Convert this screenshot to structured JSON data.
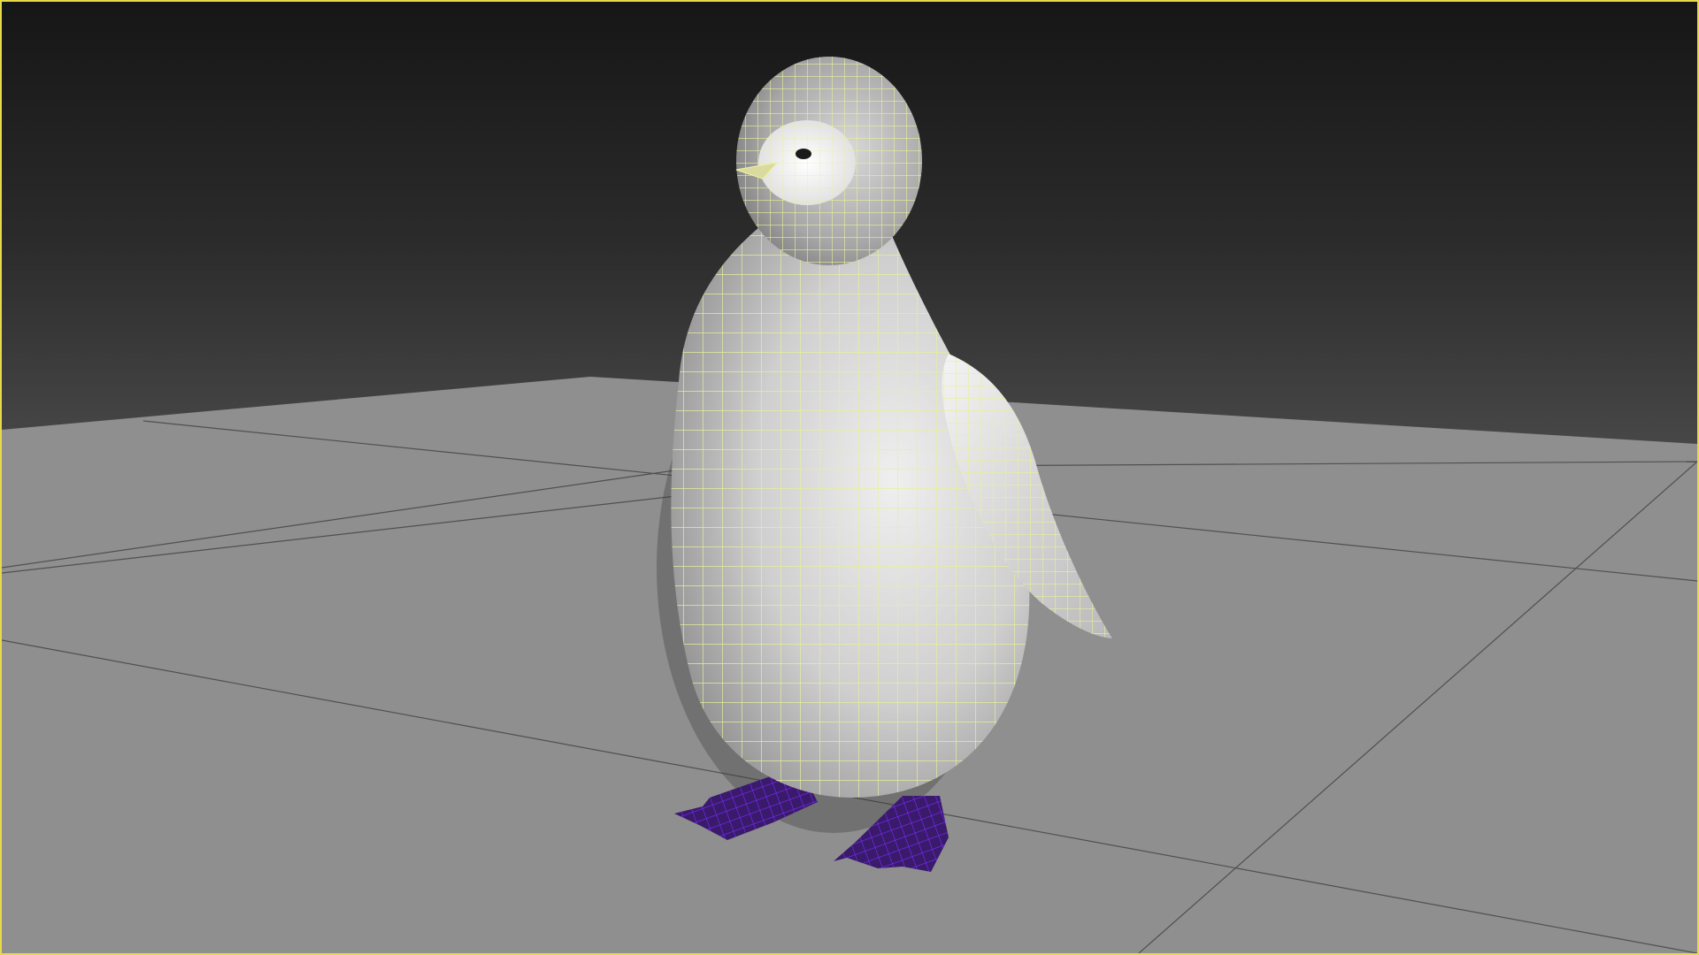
{
  "viewport": {
    "name": "3d-viewport",
    "active_border_color": "#e8d94a",
    "background_top_color": "#161616",
    "background_bottom_color": "#555555"
  },
  "scene": {
    "ground_plane": {
      "fill_color": "#8f8f8f",
      "grid_line_color": "#505050"
    },
    "model": {
      "subject": "penguin-chick",
      "display_mode": "shaded-with-wireframe",
      "wireframe_color": "#e9ef9a",
      "body_shading_color": "#d8d8d8",
      "feet_wireframe_color": "#7a2cff",
      "feet_color": "#3a1a6b",
      "fur_color": "#111111"
    }
  }
}
